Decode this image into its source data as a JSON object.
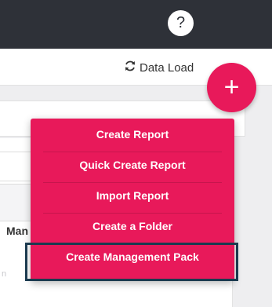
{
  "header": {
    "help_icon_glyph": "?"
  },
  "toolbar": {
    "data_load_label": "Data Load"
  },
  "background": {
    "column_label": "Man",
    "faded_text": "n"
  },
  "fab": {
    "glyph": "+"
  },
  "menu": {
    "items": [
      {
        "label": "Create Report"
      },
      {
        "label": "Quick Create Report"
      },
      {
        "label": "Import Report"
      },
      {
        "label": "Create a Folder"
      },
      {
        "label": "Create Management Pack"
      }
    ],
    "highlighted_item": "Create Management Pack"
  },
  "colors": {
    "accent": "#e8195a",
    "topbar": "#2e3138",
    "highlight_border": "#1b3a4f"
  }
}
